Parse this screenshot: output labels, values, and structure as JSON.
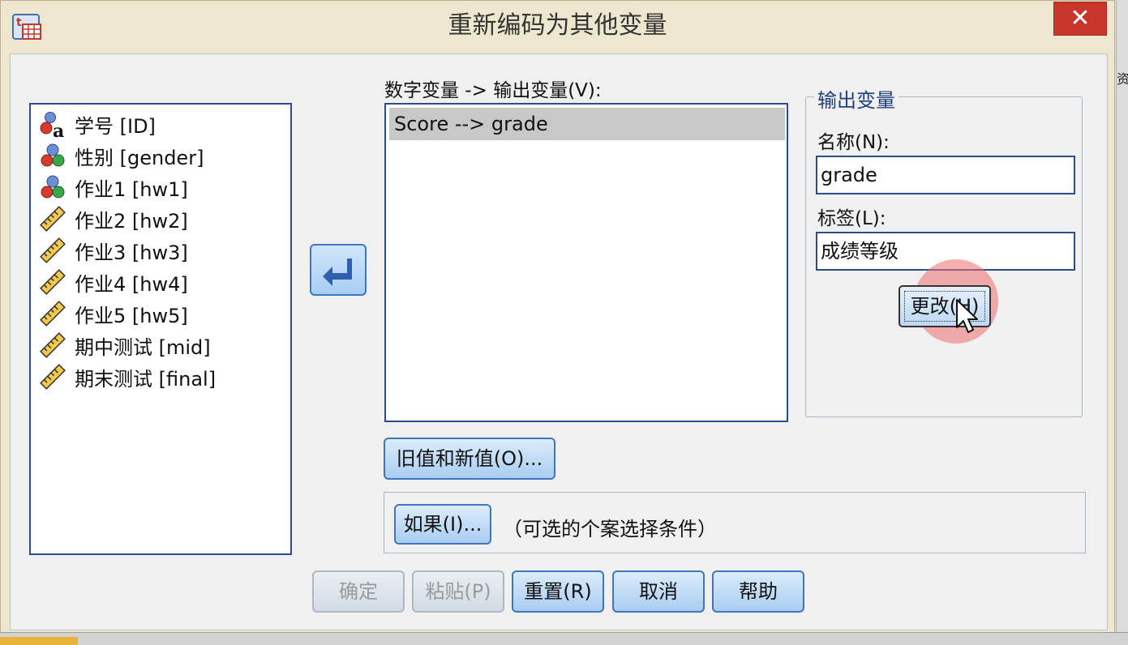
{
  "window": {
    "title": "重新编码为其他变量",
    "close_glyph": "✕"
  },
  "variables": [
    {
      "label": "学号 [ID]",
      "icon": "nominal-string-icon"
    },
    {
      "label": "性别 [gender]",
      "icon": "nominal-icon"
    },
    {
      "label": "作业1 [hw1]",
      "icon": "nominal-icon"
    },
    {
      "label": "作业2 [hw2]",
      "icon": "scale-ruler-icon"
    },
    {
      "label": "作业3 [hw3]",
      "icon": "scale-ruler-icon"
    },
    {
      "label": "作业4 [hw4]",
      "icon": "scale-ruler-icon"
    },
    {
      "label": "作业5 [hw5]",
      "icon": "scale-ruler-icon"
    },
    {
      "label": "期中测试 [mid]",
      "icon": "scale-ruler-icon"
    },
    {
      "label": "期末测试 [final]",
      "icon": "scale-ruler-icon"
    }
  ],
  "mapping": {
    "label": "数字变量 -> 输出变量(V):",
    "items": [
      "Score --> grade"
    ]
  },
  "output": {
    "group_title": "输出变量",
    "name_label": "名称(N):",
    "name_value": "grade",
    "label_label": "标签(L):",
    "label_value": "成绩等级",
    "change_label": "更改(H)"
  },
  "buttons": {
    "old_new": "旧值和新值(O)...",
    "if": "如果(I)...",
    "if_note": "（可选的个案选择条件）",
    "ok": "确定",
    "paste": "粘贴(P)",
    "reset": "重置(R)",
    "cancel": "取消",
    "help": "帮助"
  },
  "background": {
    "edge_text": "资"
  },
  "colors": {
    "close": "#c8352a",
    "list_border": "#2d4b8f",
    "button": "#a9cdf1",
    "selection": "#c8c8c8"
  }
}
